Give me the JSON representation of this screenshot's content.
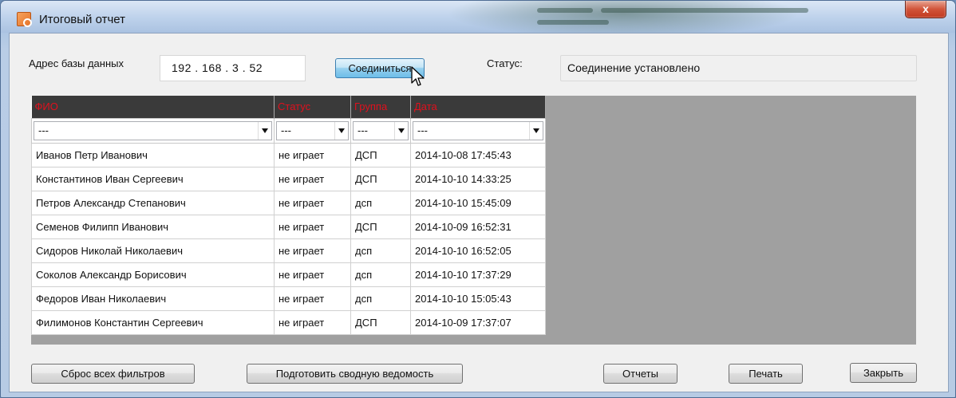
{
  "window": {
    "title": "Итоговый отчет",
    "close_label": "x"
  },
  "connection": {
    "db_address_label": "Адрес базы данных",
    "ip_value": "192 . 168 . 3 . 52",
    "connect_label": "Соединиться",
    "status_label": "Статус:",
    "status_value": "Соединение установлено"
  },
  "grid": {
    "columns": [
      "ФИО",
      "Статус",
      "Группа",
      "Дата"
    ],
    "filters": [
      "---",
      "---",
      "---",
      "---"
    ],
    "rows": [
      [
        "Иванов Петр Иванович",
        "не играет",
        "ДСП",
        "2014-10-08 17:45:43"
      ],
      [
        "Константинов Иван Сергеевич",
        "не играет",
        "ДСП",
        "2014-10-10 14:33:25"
      ],
      [
        "Петров Александр Степанович",
        "не играет",
        "дсп",
        "2014-10-10 15:45:09"
      ],
      [
        "Семенов Филипп Иванович",
        "не играет",
        "ДСП",
        "2014-10-09 16:52:31"
      ],
      [
        "Сидоров Николай Николаевич",
        "не играет",
        "дсп",
        "2014-10-10 16:52:05"
      ],
      [
        "Соколов Александр Борисович",
        "не играет",
        "дсп",
        "2014-10-10 17:37:29"
      ],
      [
        "Федоров Иван Николаевич",
        "не играет",
        "дсп",
        "2014-10-10 15:05:43"
      ],
      [
        "Филимонов Константин Сергеевич",
        "не играет",
        "ДСП",
        "2014-10-09 17:37:07"
      ]
    ]
  },
  "footer": {
    "reset_filters_label": "Сброс всех фильтров",
    "prepare_summary_label": "Подготовить сводную ведомость",
    "reports_label": "Отчеты",
    "print_label": "Печать",
    "close_label": "Закрыть"
  },
  "colors": {
    "header_bg": "#3a3a3a",
    "header_text": "#e0101d",
    "focused_button": "#98d1ef"
  }
}
